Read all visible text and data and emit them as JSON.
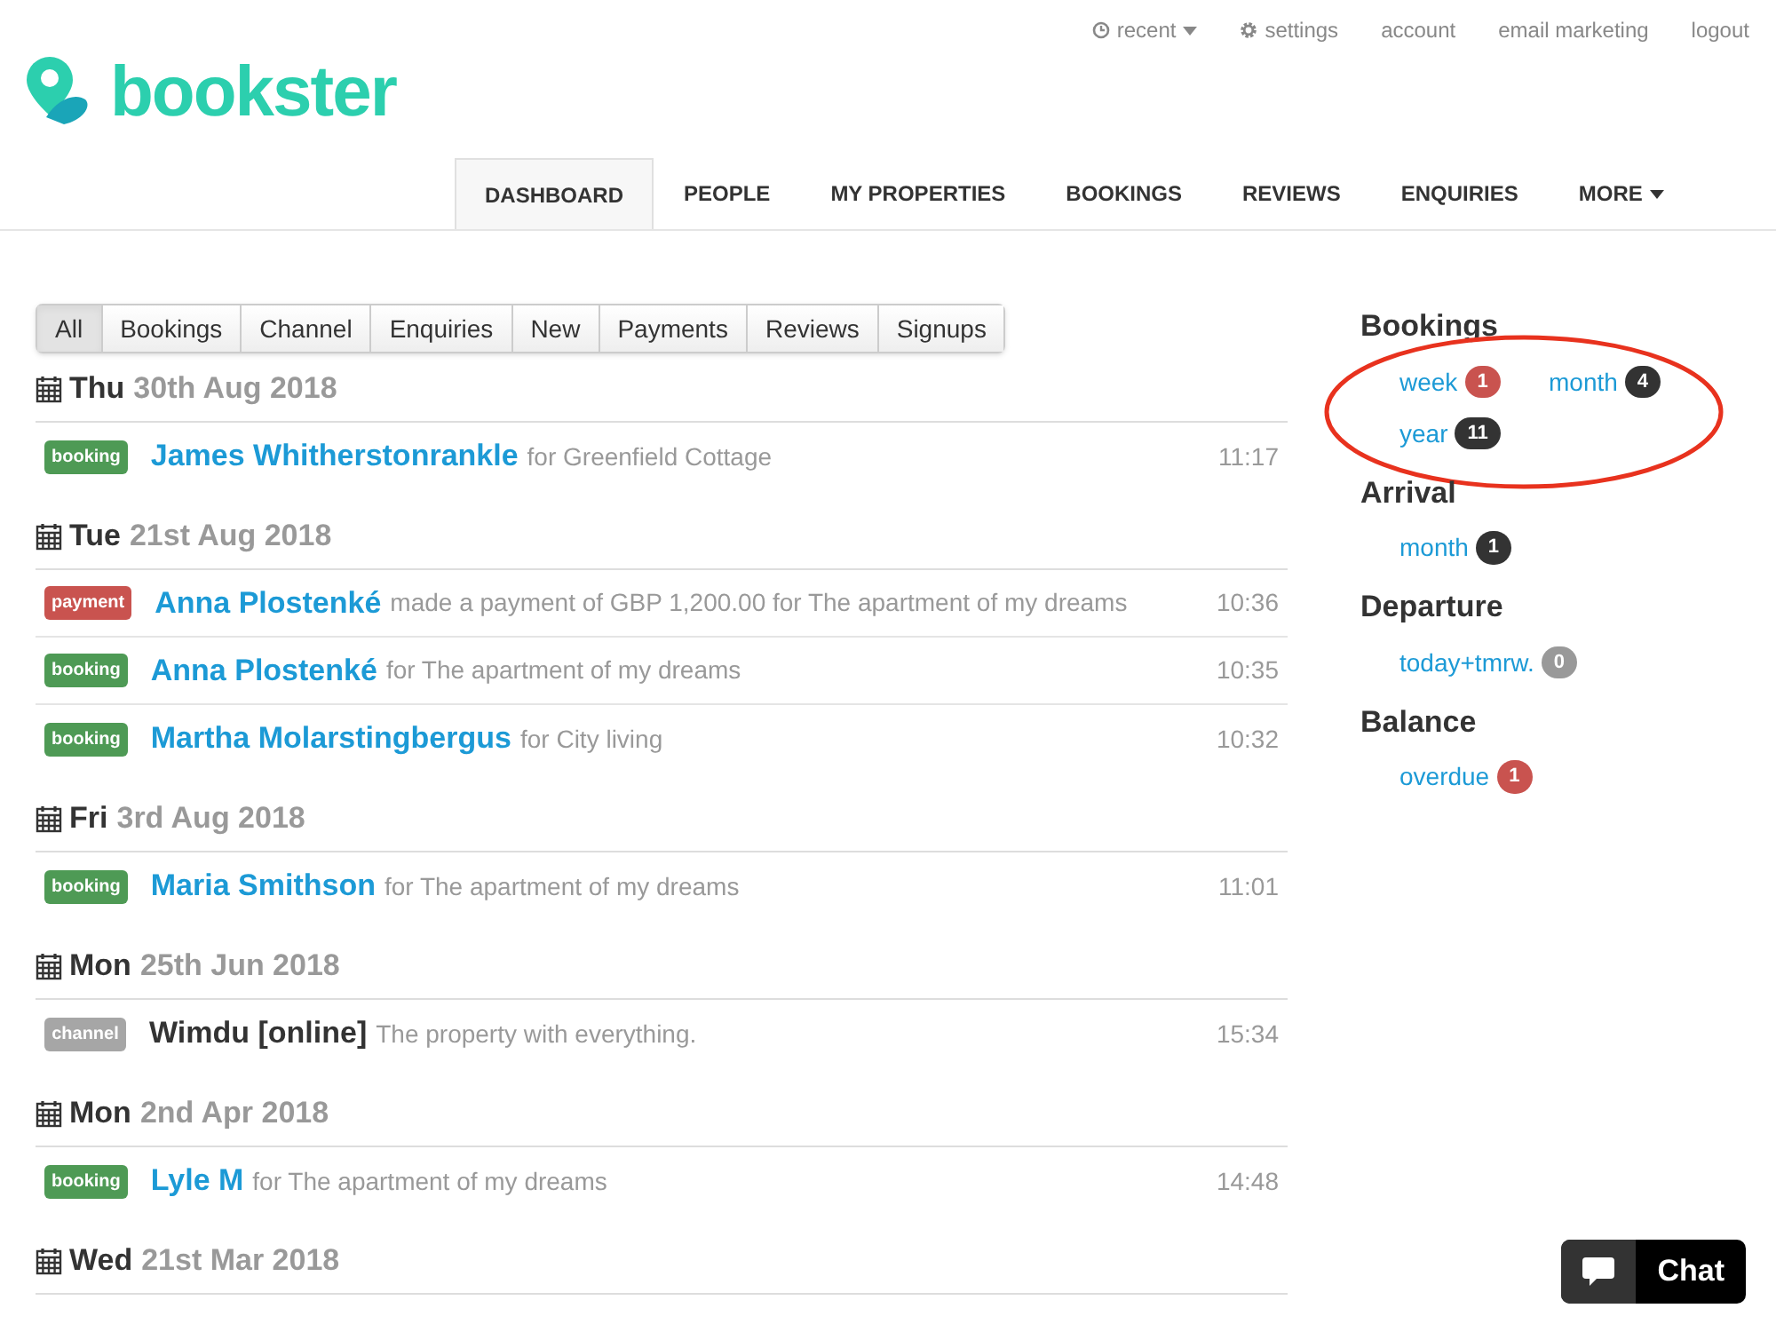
{
  "top_links": [
    {
      "label": "recent",
      "kind": "clock",
      "caret": true
    },
    {
      "label": "settings",
      "kind": "gear",
      "caret": false
    },
    {
      "label": "account",
      "kind": "plain",
      "caret": false
    },
    {
      "label": "email marketing",
      "kind": "plain",
      "caret": false
    },
    {
      "label": "logout",
      "kind": "plain",
      "caret": false
    }
  ],
  "logo": {
    "text": "bookster"
  },
  "nav": [
    {
      "label": "DASHBOARD",
      "selected": true,
      "caret": false
    },
    {
      "label": "PEOPLE",
      "selected": false,
      "caret": false
    },
    {
      "label": "MY PROPERTIES",
      "selected": false,
      "caret": false
    },
    {
      "label": "BOOKINGS",
      "selected": false,
      "caret": false
    },
    {
      "label": "REVIEWS",
      "selected": false,
      "caret": false
    },
    {
      "label": "ENQUIRIES",
      "selected": false,
      "caret": false
    },
    {
      "label": "MORE",
      "selected": false,
      "caret": true
    }
  ],
  "filters": [
    {
      "label": "All",
      "selected": true
    },
    {
      "label": "Bookings",
      "selected": false
    },
    {
      "label": "Channel",
      "selected": false
    },
    {
      "label": "Enquiries",
      "selected": false
    },
    {
      "label": "New",
      "selected": false
    },
    {
      "label": "Payments",
      "selected": false
    },
    {
      "label": "Reviews",
      "selected": false
    },
    {
      "label": "Signups",
      "selected": false
    }
  ],
  "feed": [
    {
      "day": "Thu",
      "date": "30th Aug 2018",
      "entries": [
        {
          "kind": "booking",
          "tag": "booking",
          "name": "James Whitherstonrankle",
          "link": true,
          "detail": "for Greenfield Cottage",
          "time": "11:17"
        }
      ]
    },
    {
      "day": "Tue",
      "date": "21st Aug 2018",
      "entries": [
        {
          "kind": "payment",
          "tag": "payment",
          "name": "Anna Plostenké",
          "link": true,
          "detail": "made a payment of GBP 1,200.00 for The apartment of my dreams",
          "time": "10:36"
        },
        {
          "kind": "booking",
          "tag": "booking",
          "name": "Anna Plostenké",
          "link": true,
          "detail": "for The apartment of my dreams",
          "time": "10:35"
        },
        {
          "kind": "booking",
          "tag": "booking",
          "name": "Martha Molarstingbergus",
          "link": true,
          "detail": "for City living",
          "time": "10:32"
        }
      ]
    },
    {
      "day": "Fri",
      "date": "3rd Aug 2018",
      "entries": [
        {
          "kind": "booking",
          "tag": "booking",
          "name": "Maria Smithson",
          "link": true,
          "detail": "for The apartment of my dreams",
          "time": "11:01"
        }
      ]
    },
    {
      "day": "Mon",
      "date": "25th Jun 2018",
      "entries": [
        {
          "kind": "channel",
          "tag": "channel",
          "name": "Wimdu [online]",
          "link": false,
          "detail": "The property with everything.",
          "time": "15:34"
        }
      ]
    },
    {
      "day": "Mon",
      "date": "2nd Apr 2018",
      "entries": [
        {
          "kind": "booking",
          "tag": "booking",
          "name": "Lyle M",
          "link": true,
          "detail": "for The apartment of my dreams",
          "time": "14:48"
        }
      ]
    },
    {
      "day": "Wed",
      "date": "21st Mar 2018"
    }
  ],
  "sidebar": [
    {
      "title": "Bookings",
      "annotated": true,
      "stats": [
        {
          "label": "week",
          "count": "1",
          "color": "#c9534f"
        },
        {
          "label": "month",
          "count": "4",
          "color": "#333333"
        },
        {
          "label": "year",
          "count": "11",
          "color": "#333333"
        }
      ]
    },
    {
      "title": "Arrival",
      "annotated": false,
      "stats": [
        {
          "label": "month",
          "count": "1",
          "color": "#333333"
        }
      ]
    },
    {
      "title": "Departure",
      "annotated": false,
      "stats": [
        {
          "label": "today+tmrw.",
          "count": "0",
          "color": "#999999"
        }
      ]
    },
    {
      "title": "Balance",
      "annotated": false,
      "stats": [
        {
          "label": "overdue",
          "count": "1",
          "color": "#c9534f"
        }
      ]
    }
  ],
  "chat": {
    "label": "Chat"
  }
}
